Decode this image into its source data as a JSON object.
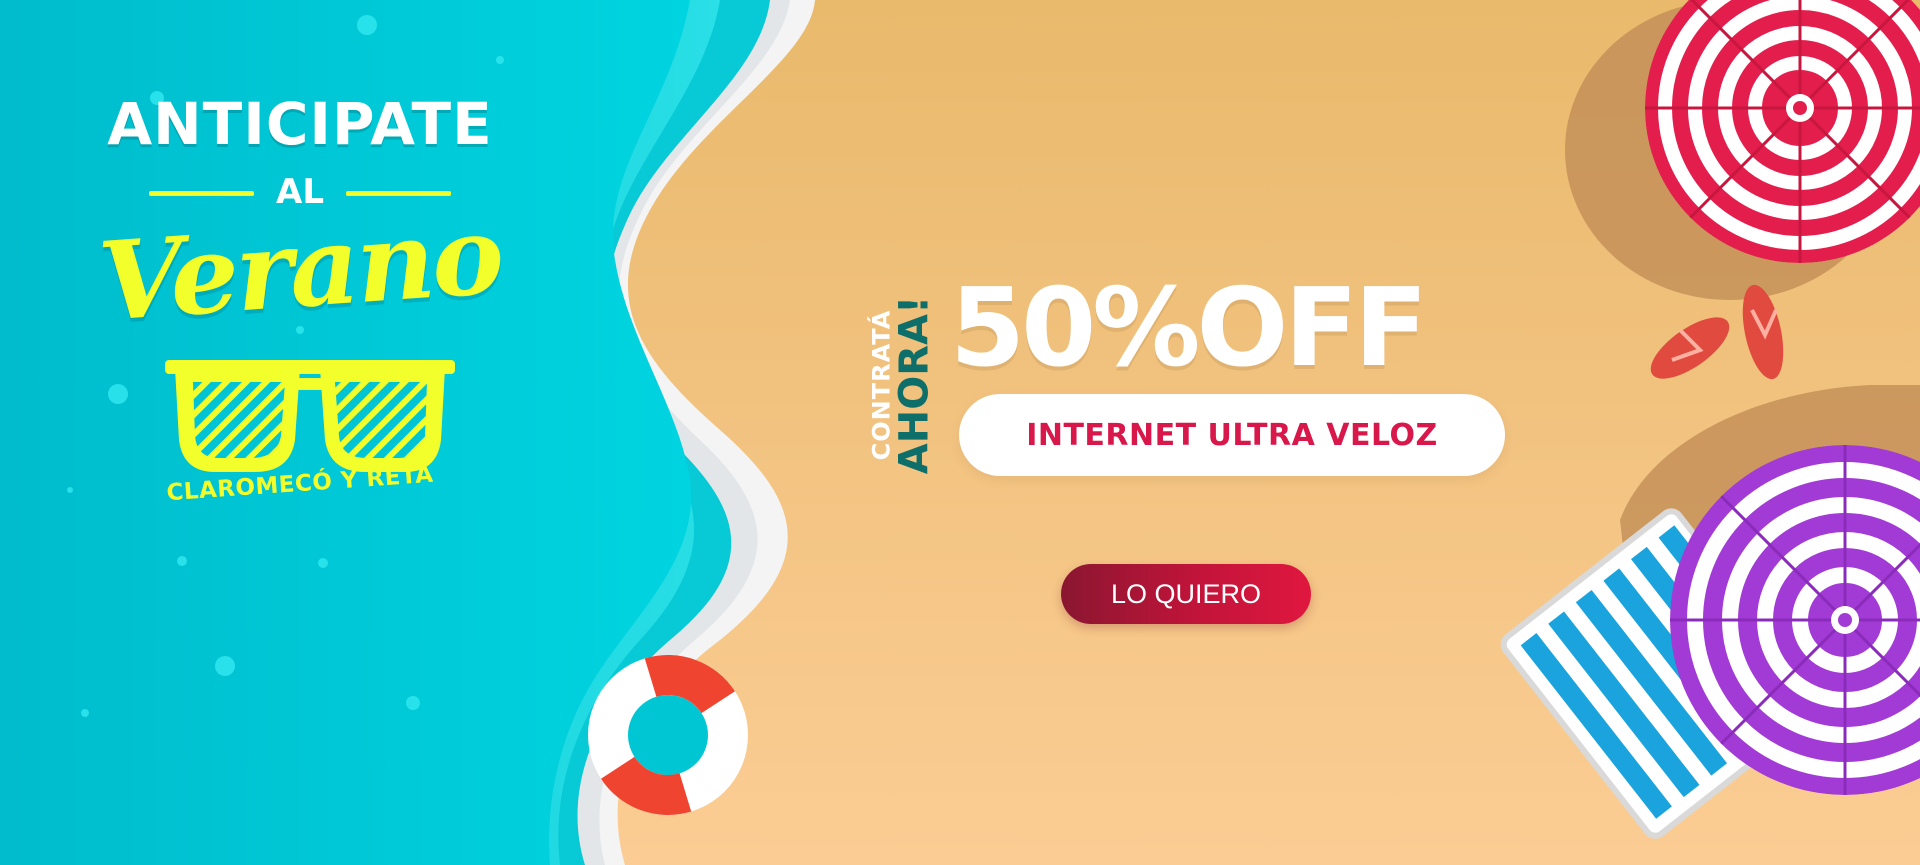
{
  "headline": {
    "line1": "ANTICIPATE",
    "line2": "AL",
    "line3": "Verano",
    "location": "CLAROMECÓ Y RETA"
  },
  "promo": {
    "vertical_small": "CONTRATÁ",
    "vertical_large": "AHORA!",
    "discount": "50%OFF",
    "product": "INTERNET ULTRA VELOZ"
  },
  "cta": {
    "label": "LO QUIERO"
  },
  "colors": {
    "sea": "#00c4d4",
    "sand": "#f0c07a",
    "headline_yellow": "#f2ff2a",
    "headline_white": "#ffffff",
    "product_text": "#d8174a",
    "cta_gradient_start": "#8a1630",
    "cta_gradient_end": "#e0173f",
    "vertical_accent": "#0e6e6a"
  },
  "icons": [
    "sunglasses-icon",
    "life-ring-icon",
    "beach-umbrella-red-icon",
    "beach-umbrella-purple-icon",
    "flip-flops-icon",
    "beach-chair-icon"
  ]
}
